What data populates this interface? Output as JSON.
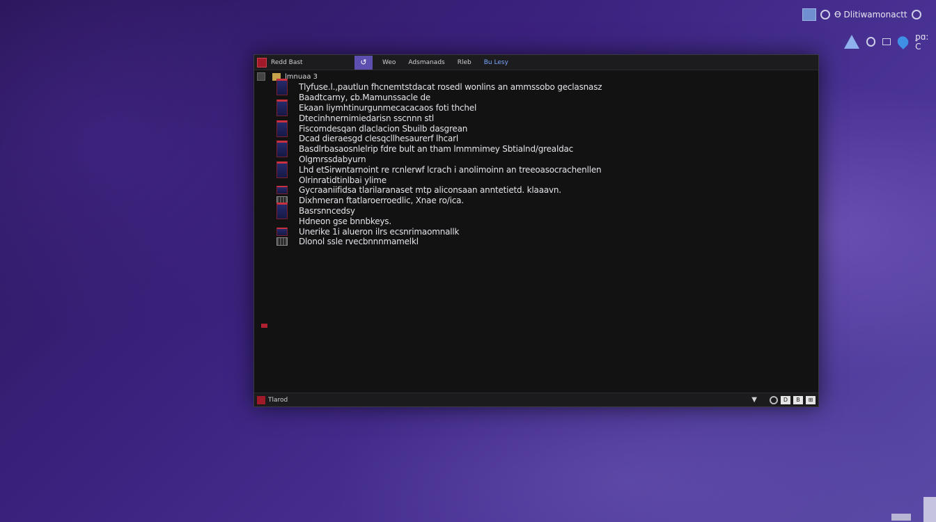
{
  "tray": {
    "top_label": "Ꝋ Dlitiwamonactt",
    "bottom_label": "ꝑɑ: C"
  },
  "window": {
    "title": "Redd Bast",
    "nav_glyph": "↺",
    "menu": [
      "Weo",
      "Adsmanads",
      "Rleb",
      "Bu Lesy"
    ],
    "tree_header": "lmnuaa 3",
    "rows": [
      {
        "text": "Tlyfuse.l.,pautlun fhcnemtstdacat rosedl wonlins an ammssobo geclasnasz",
        "icon": "file"
      },
      {
        "text": "Baadtcarny, ɕb.Mamunssacle de",
        "icon": "none"
      },
      {
        "text": "Ekaan liymhtinurgunmecacacaos foti thchel",
        "icon": "file"
      },
      {
        "text": "Dtecinhnernimiedarisn sscnnn stl",
        "icon": "none"
      },
      {
        "text": "Fiscomdesqan dlaclacion Sbuilb dasgrean",
        "icon": "file"
      },
      {
        "text": "Dcad dieraesgd clesqcllhesaurerf lhcarl",
        "icon": "none"
      },
      {
        "text": "Basdlrbasaosnlelrip fdre bult an tham lmmmimey Sbtialnd/grealdac",
        "icon": "file"
      },
      {
        "text": "Olgmrssdabyurn",
        "icon": "none"
      },
      {
        "text": "Lhd etSirwntarnoint re rcnlerwf lcrach i anolimoinn an treeoasocrachenllen",
        "icon": "file"
      },
      {
        "text": "Olrinratidtinlbai ylime",
        "icon": "none"
      },
      {
        "text": "Gycraaniifidsa tlarilaranaset mtp aliconsaan anntetietd. klaaavn.",
        "icon": "file-small"
      },
      {
        "text": "Dixhmeran ftatlaroerroedlic, Xnae ro/ica.",
        "icon": "grid"
      },
      {
        "text": "Basrsnncedsy",
        "icon": "file"
      },
      {
        "text": "Hdneon gse bnnbkeys.",
        "icon": "none"
      },
      {
        "text": "Unerike 1i alueron ilrs ecsnrimaomnallk",
        "icon": "file-small"
      },
      {
        "text": "Dlonol ssle rvecbnnnmamelkl",
        "icon": "grid"
      }
    ],
    "status_label": "Tlarod",
    "status_chevron": "▼",
    "status_boxes": [
      "D",
      "B",
      "⊞"
    ]
  }
}
